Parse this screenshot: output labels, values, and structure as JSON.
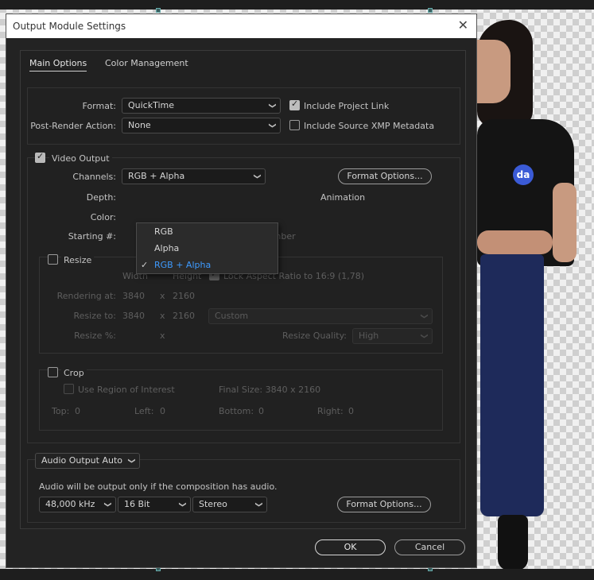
{
  "dialog": {
    "title": "Output Module Settings",
    "close_glyph": "✕"
  },
  "tabs": [
    {
      "label": "Main Options",
      "active": true
    },
    {
      "label": "Color Management",
      "active": false
    }
  ],
  "main": {
    "format_label": "Format:",
    "format_value": "QuickTime",
    "post_render_label": "Post-Render Action:",
    "post_render_value": "None",
    "include_project_link": {
      "label": "Include Project Link",
      "checked": true
    },
    "include_xmp": {
      "label": "Include Source XMP Metadata",
      "checked": false
    }
  },
  "video": {
    "label": "Video Output",
    "checked": true,
    "channels_label": "Channels:",
    "channels_value": "RGB + Alpha",
    "depth_label": "Depth:",
    "color_label": "Color:",
    "starting_label": "Starting #:",
    "use_comp_frame": "Use Comp Frame Number",
    "format_options_btn": "Format Options...",
    "codec_text": "Animation",
    "menu": [
      {
        "label": "RGB",
        "selected": false
      },
      {
        "label": "Alpha",
        "selected": false
      },
      {
        "label": "RGB + Alpha",
        "selected": true
      }
    ],
    "menu_check": "✓"
  },
  "resize": {
    "label": "Resize",
    "checked": false,
    "width_head": "Width",
    "height_head": "Height",
    "lock_label": "Lock Aspect Ratio to 16:9 (1,78)",
    "lock_checked": true,
    "rendering_label": "Rendering at:",
    "rendering_w": "3840",
    "rendering_h": "2160",
    "resize_to_label": "Resize to:",
    "resize_to_w": "3840",
    "resize_to_h": "2160",
    "resize_to_preset": "Custom",
    "resize_pct_label": "Resize %:",
    "x_sep": "x",
    "quality_label": "Resize Quality:",
    "quality_value": "High"
  },
  "crop": {
    "label": "Crop",
    "checked": false,
    "roi_label": "Use Region of Interest",
    "final_size": "Final Size: 3840 x 2160",
    "top_label": "Top:",
    "top_value": "0",
    "left_label": "Left:",
    "left_value": "0",
    "bottom_label": "Bottom:",
    "bottom_value": "0",
    "right_label": "Right:",
    "right_value": "0"
  },
  "audio": {
    "mode": "Audio Output Auto",
    "note": "Audio will be output only if the composition has audio.",
    "rate": "48,000 kHz",
    "bits": "16 Bit",
    "channels": "Stereo",
    "format_options_btn": "Format Options..."
  },
  "buttons": {
    "ok": "OK",
    "cancel": "Cancel"
  },
  "background": {
    "shirt_logo": "da"
  }
}
